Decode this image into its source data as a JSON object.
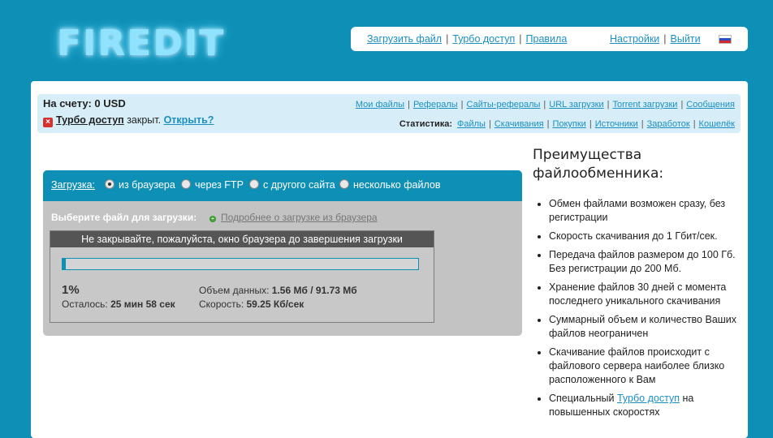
{
  "header": {
    "logo_text": "FIREDIT",
    "nav_left": [
      "Загрузить файл",
      "Турбо доступ",
      "Правила"
    ],
    "nav_right": [
      "Настройки",
      "Выйти"
    ],
    "separator": "|"
  },
  "account": {
    "balance": "На счету: 0 USD",
    "turbo_link": "Турбо доступ",
    "turbo_status": " закрыт. ",
    "open_link": "Открыть?",
    "menu_primary": [
      "Мои файлы",
      "Рефералы",
      "Сайты-рефералы",
      "URL загрузки",
      "Torrent загрузки",
      "Сообщения"
    ],
    "stats_label": "Статистика:",
    "menu_stats": [
      "Файлы",
      "Скачивания",
      "Покупки",
      "Источники",
      "Заработок",
      "Кошелёк"
    ]
  },
  "upload": {
    "label": "Загрузка:",
    "options": [
      "из браузера",
      "через FTP",
      "с другого сайта",
      "несколько файлов"
    ],
    "selected": "из браузера",
    "choose_text": "Выберите файл для загрузки:",
    "more_link": "Подробнее о загрузке из браузера",
    "progress": {
      "notice": "Не закрывайте, пожалуйста, окно браузера до завершения загрузки",
      "percent_value": 1,
      "percent_text": "1%",
      "remaining_label": "Осталось: ",
      "remaining_value": "25 мин 58 сек",
      "volume_label": "Объем данных: ",
      "volume_value": "1.56 Мб / 91.73 Мб",
      "speed_label": "Скорость: ",
      "speed_value": "59.25 Кб/сек"
    }
  },
  "sidebar": {
    "title": "Преимущества файлообменника:",
    "items": [
      "Обмен файлами возможен сразу, без регистрации",
      "Скорость скачивания до 1 Гбит/сек.",
      "Передача файлов размером до 100 Гб. Без регистрации до 200 Мб.",
      "Хранение файлов 30 дней с момента последнего уникального скачивания",
      "Суммарный объем и количество Ваших файлов неограничен",
      "Скачивание файлов происходит с файлового сервера наиболее близко расположенного к Вам"
    ],
    "last_item_prefix": "Специальный ",
    "last_item_link": "Турбо доступ",
    "last_item_suffix": " на повышенных скоростях"
  },
  "colors": {
    "brand": "#0e8fb6",
    "link": "#1b8fc2",
    "infobar": "#d7eef8"
  }
}
